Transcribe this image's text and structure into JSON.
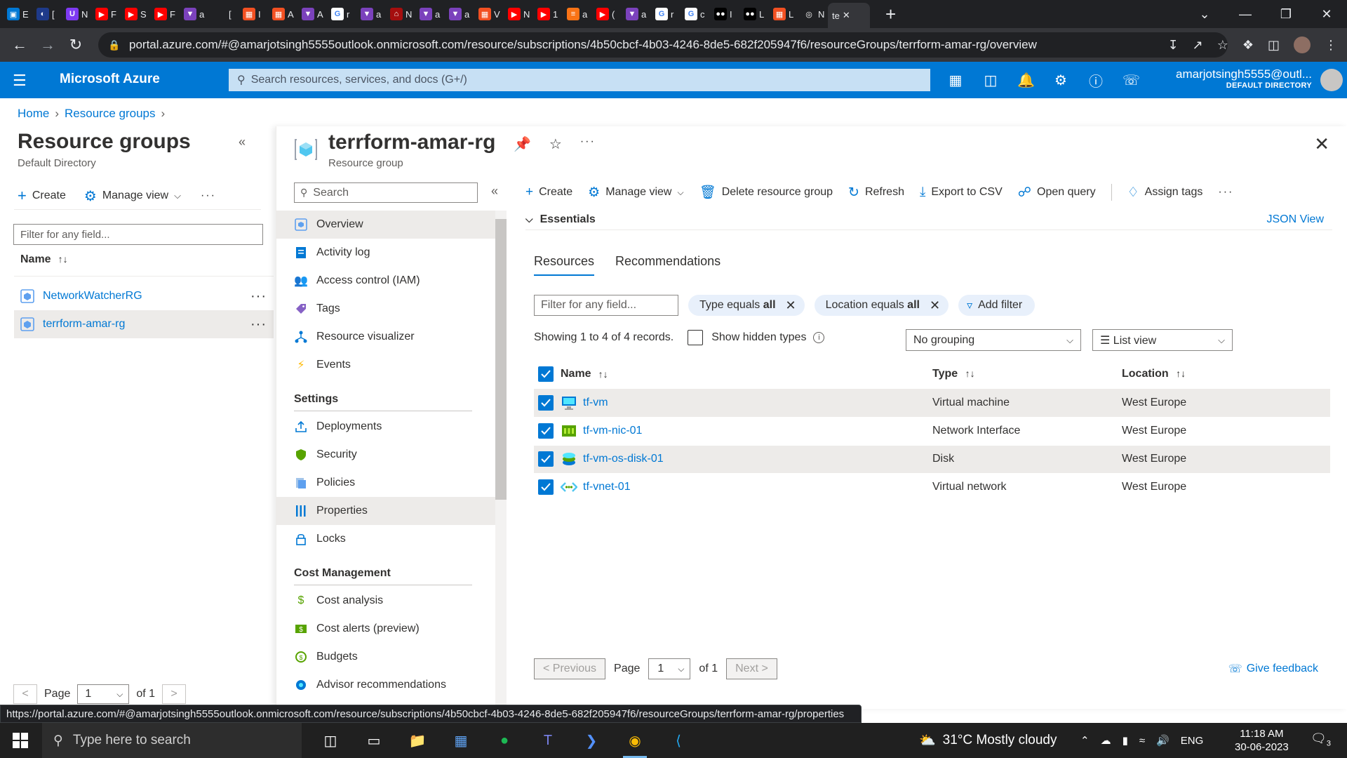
{
  "browser": {
    "tabs": [
      {
        "letter": "E",
        "color": "#0078d4",
        "glyph": "▣"
      },
      {
        "letter": "[",
        "color": "#1e3a8a",
        "glyph": "◐"
      },
      {
        "letter": "N",
        "color": "#7e3af2",
        "glyph": "U"
      },
      {
        "letter": "F",
        "color": "#ff0000",
        "glyph": "▶"
      },
      {
        "letter": "S",
        "color": "#ff0000",
        "glyph": "▶"
      },
      {
        "letter": "F",
        "color": "#ff0000",
        "glyph": "▶"
      },
      {
        "letter": "a",
        "color": "#7b42bc",
        "glyph": "▼"
      },
      {
        "letter": "[",
        "color": "#202124",
        "glyph": ""
      },
      {
        "letter": "I",
        "color": "#f25022",
        "glyph": "▦"
      },
      {
        "letter": "A",
        "color": "#f25022",
        "glyph": "▦"
      },
      {
        "letter": "A",
        "color": "#7b42bc",
        "glyph": "▼"
      },
      {
        "letter": "r",
        "color": "#ffffff",
        "glyph": "G"
      },
      {
        "letter": "a",
        "color": "#7b42bc",
        "glyph": "▼"
      },
      {
        "letter": "N",
        "color": "#a50e0e",
        "glyph": "⌂"
      },
      {
        "letter": "a",
        "color": "#7b42bc",
        "glyph": "▼"
      },
      {
        "letter": "a",
        "color": "#7b42bc",
        "glyph": "▼"
      },
      {
        "letter": "V",
        "color": "#f25022",
        "glyph": "▦"
      },
      {
        "letter": "N",
        "color": "#ff0000",
        "glyph": "▶"
      },
      {
        "letter": "1",
        "color": "#ff0000",
        "glyph": "▶"
      },
      {
        "letter": "a",
        "color": "#f97316",
        "glyph": "≡"
      },
      {
        "letter": "(",
        "color": "#ff0000",
        "glyph": "▶"
      },
      {
        "letter": "a",
        "color": "#7b42bc",
        "glyph": "▼"
      },
      {
        "letter": "r",
        "color": "#ffffff",
        "glyph": "G"
      },
      {
        "letter": "c",
        "color": "#ffffff",
        "glyph": "G"
      },
      {
        "letter": "I",
        "color": "#000000",
        "glyph": "●●"
      },
      {
        "letter": "L",
        "color": "#000000",
        "glyph": "●●"
      },
      {
        "letter": "L",
        "color": "#f25022",
        "glyph": "▦"
      },
      {
        "letter": "N",
        "color": "#202124",
        "glyph": "◎"
      }
    ],
    "active_tab_label": "te",
    "url": "portal.azure.com/#@amarjotsingh5555outlook.onmicrosoft.com/resource/subscriptions/4b50cbcf-4b03-4246-8de5-682f205947f6/resourceGroups/terrform-amar-rg/overview",
    "status_url": "https://portal.azure.com/#@amarjotsingh5555outlook.onmicrosoft.com/resource/subscriptions/4b50cbcf-4b03-4246-8de5-682f205947f6/resourceGroups/terrform-amar-rg/properties"
  },
  "azure": {
    "brand": "Microsoft Azure",
    "search_placeholder": "Search resources, services, and docs (G+/)",
    "user_email": "amarjotsingh5555@outl...",
    "user_directory": "DEFAULT DIRECTORY",
    "brand_color": "#0078d4"
  },
  "breadcrumb": [
    "Home",
    "Resource groups"
  ],
  "left_panel": {
    "title": "Resource groups",
    "subtitle": "Default Directory",
    "create": "Create",
    "manage_view": "Manage view",
    "filter_placeholder": "Filter for any field...",
    "name_header": "Name",
    "sort_icon": "↑↓",
    "items": [
      "NetworkWatcherRG",
      "terrform-amar-rg"
    ],
    "page_label": "Page",
    "page_value": "1",
    "page_of": "of 1"
  },
  "blade": {
    "title": "terrform-amar-rg",
    "subtitle": "Resource group",
    "menu_search": "Search",
    "menu": {
      "top": [
        "Overview",
        "Activity log",
        "Access control (IAM)",
        "Tags",
        "Resource visualizer",
        "Events"
      ],
      "settings_header": "Settings",
      "settings": [
        "Deployments",
        "Security",
        "Policies",
        "Properties",
        "Locks"
      ],
      "cost_header": "Cost Management",
      "cost": [
        "Cost analysis",
        "Cost alerts (preview)",
        "Budgets",
        "Advisor recommendations"
      ]
    },
    "commands": [
      "Create",
      "Manage view",
      "Delete resource group",
      "Refresh",
      "Export to CSV",
      "Open query",
      "Assign tags"
    ],
    "essentials": "Essentials",
    "json_view": "JSON View",
    "tabs": [
      "Resources",
      "Recommendations"
    ],
    "filter_placeholder": "Filter for any field...",
    "filter_type_prefix": "Type equals",
    "filter_type_value": "all",
    "filter_location_prefix": "Location equals",
    "filter_location_value": "all",
    "add_filter": "Add filter",
    "showing": "Showing 1 to 4 of 4 records.",
    "show_hidden": "Show hidden types",
    "grouping": "No grouping",
    "view": "List view",
    "columns": {
      "name": "Name",
      "type": "Type",
      "location": "Location"
    },
    "resources": [
      {
        "name": "tf-vm",
        "type": "Virtual machine",
        "location": "West Europe"
      },
      {
        "name": "tf-vm-nic-01",
        "type": "Network Interface",
        "location": "West Europe"
      },
      {
        "name": "tf-vm-os-disk-01",
        "type": "Disk",
        "location": "West Europe"
      },
      {
        "name": "tf-vnet-01",
        "type": "Virtual network",
        "location": "West Europe"
      }
    ],
    "pager": {
      "previous": "< Previous",
      "page": "Page",
      "page_value": "1",
      "of": "of 1",
      "next": "Next >"
    },
    "feedback": "Give feedback"
  },
  "taskbar": {
    "search_placeholder": "Type here to search",
    "weather": "31°C  Mostly cloudy",
    "language": "ENG",
    "time": "11:18 AM",
    "date": "30-06-2023",
    "notifications": "3"
  }
}
